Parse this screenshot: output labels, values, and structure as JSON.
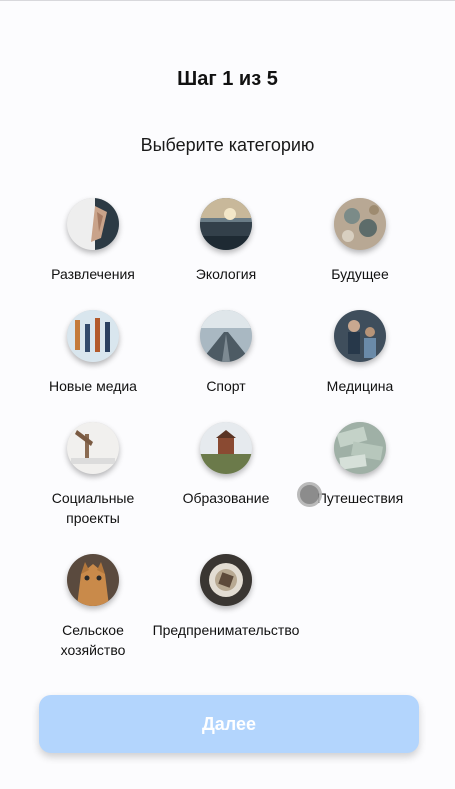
{
  "header": {
    "step": "Шаг 1 из 5",
    "prompt": "Выберите категорию"
  },
  "categories": [
    {
      "label": "Развлечения",
      "icon": "entertainment-photo"
    },
    {
      "label": "Экология",
      "icon": "ecology-photo"
    },
    {
      "label": "Будущее",
      "icon": "future-photo"
    },
    {
      "label": "Новые медиа",
      "icon": "new-media-photo"
    },
    {
      "label": "Спорт",
      "icon": "sport-photo"
    },
    {
      "label": "Медицина",
      "icon": "medicine-photo"
    },
    {
      "label": "Социальные\nпроекты",
      "icon": "social-projects-photo"
    },
    {
      "label": "Образование",
      "icon": "education-photo"
    },
    {
      "label": "Путешествия",
      "icon": "travel-photo"
    },
    {
      "label": "Сельское\nхозяйство",
      "icon": "agriculture-photo"
    },
    {
      "label": "Предпренимательство",
      "icon": "entrepreneurship-photo"
    }
  ],
  "footer": {
    "next_label": "Далее"
  },
  "colors": {
    "button_bg": "#b3d5fd",
    "button_text": "#ffffff",
    "background": "#fcfcfe"
  }
}
